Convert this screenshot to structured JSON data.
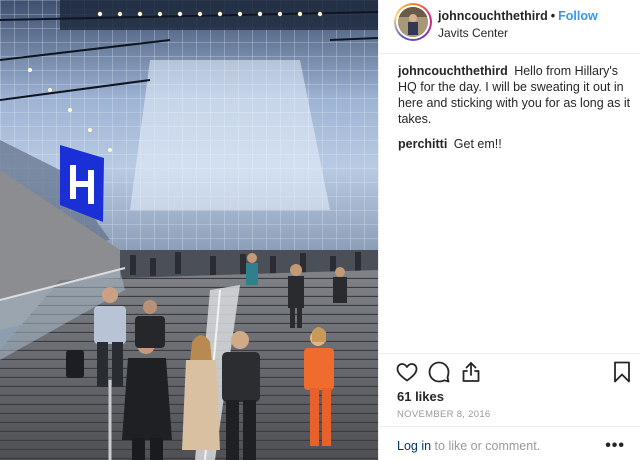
{
  "post": {
    "image_alt": "",
    "username": "johncouchthethird",
    "separator": "•",
    "follow_label": "Follow",
    "location": "Javits Center",
    "comments": [
      {
        "user": "johncouchthethird",
        "text": "Hello from Hillary's HQ for the day. I will be sweating it out in here and sticking with you for as long as it takes."
      },
      {
        "user": "perchitti",
        "text": "Get em!!"
      }
    ],
    "likes": "61 likes",
    "date": "NOVEMBER 8, 2016",
    "login_link": "Log in",
    "login_text": "to like or comment.",
    "more_label": "•••"
  },
  "icons": {
    "like": "heart-icon",
    "comment": "comment-icon",
    "share": "share-icon",
    "save": "bookmark-icon",
    "more": "more-options-icon"
  },
  "colors": {
    "follow": "#3897f0",
    "link": "#003569",
    "muted": "#999999",
    "text": "#262626",
    "sign_blue": "#1b2fd6"
  }
}
